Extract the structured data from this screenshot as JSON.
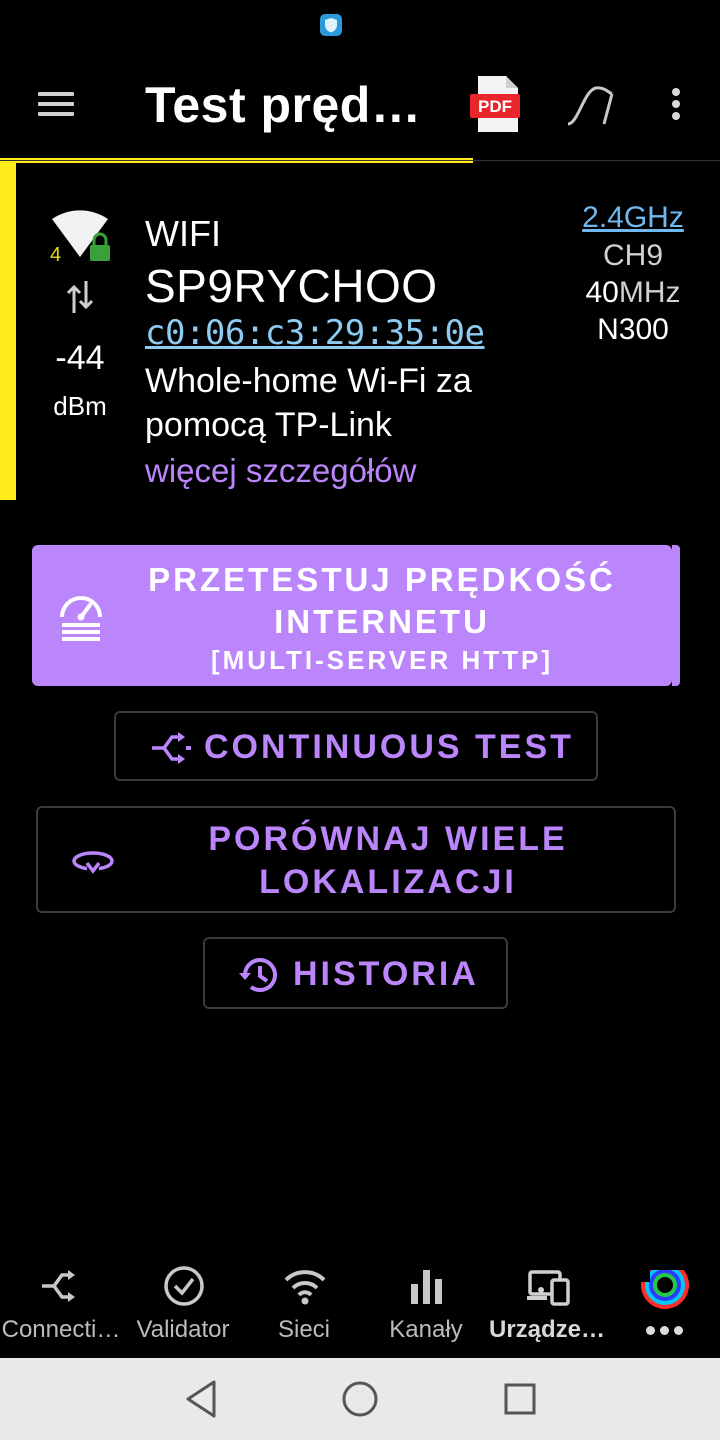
{
  "app_bar": {
    "title": "Test pręd…"
  },
  "wifi": {
    "signal_level": "4",
    "rssi": "-44",
    "rssi_unit": "dBm",
    "type": "WIFI",
    "ssid": "SP9RYCHOO",
    "bssid": "c0:06:c3:29:35:0e",
    "vendor": "Whole-home Wi-Fi za pomocą TP-Link",
    "more_details": "więcej szczegółów",
    "band": "2.4GHz",
    "channel": "CH9",
    "width_value": "40",
    "width_unit": "MHz",
    "standard": "N300"
  },
  "buttons": {
    "speedtest_line1": "PRZETESTUJ PRĘDKOŚĆ",
    "speedtest_line2": "INTERNETU",
    "speedtest_sub": "[MULTI-SERVER HTTP]",
    "continuous": "CONTINUOUS TEST",
    "compare": "PORÓWNAJ WIELE LOKALIZACJI",
    "history": "HISTORIA"
  },
  "bottom_nav": {
    "items": [
      {
        "label": "Connecti…",
        "icon": "connection-icon"
      },
      {
        "label": "Validator",
        "icon": "check-circle-icon"
      },
      {
        "label": "Sieci",
        "icon": "wifi-icon"
      },
      {
        "label": "Kanały",
        "icon": "bar-chart-icon"
      },
      {
        "label": "Urządze…",
        "icon": "devices-icon"
      }
    ],
    "more_icon": "rainbow-icon"
  },
  "colors": {
    "accent_purple": "#bb86fc",
    "accent_yellow": "#ffec1a",
    "link_blue": "#8ecbf0"
  }
}
